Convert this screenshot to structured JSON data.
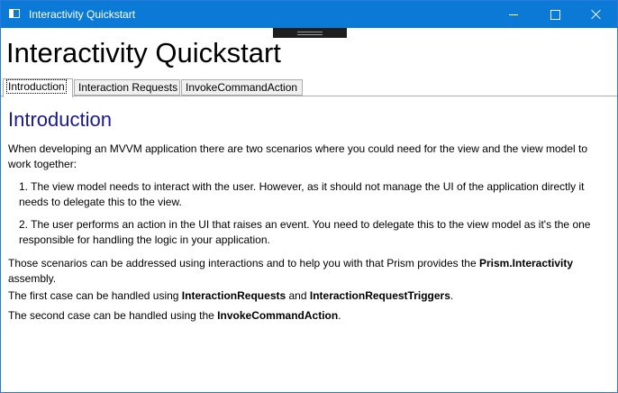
{
  "window": {
    "title": "Interactivity Quickstart",
    "title_bar_color": "#0b7ad7",
    "icons": {
      "app": "window-icon",
      "minimize": "minimize-icon",
      "maximize": "maximize-icon",
      "close": "close-icon"
    }
  },
  "header": {
    "title": "Interactivity Quickstart"
  },
  "tabs": [
    {
      "label": "Introduction",
      "selected": true
    },
    {
      "label": "Interaction Requests",
      "selected": false
    },
    {
      "label": "InvokeCommandAction",
      "selected": false
    }
  ],
  "content": {
    "heading": "Introduction",
    "heading_color": "#1a1a8c",
    "intro": "When developing an MVVM application there are two scenarios where you could need for the view and the view model to work together:",
    "list_items": [
      "1. The view model needs to interact with the user. However, as it should not manage the UI of the application directly it needs to delegate this to the view.",
      "2. The user performs an action in the UI that raises an event. You need to delegate this to the view model as it's the one responsible for handling the logic in your application."
    ],
    "scenarios": {
      "prefix": "Those scenarios can be addressed using interactions and to help you with that Prism provides the ",
      "bold": "Prism.Interactivity",
      "suffix": " assembly."
    },
    "first_case": {
      "prefix": "The first case can be handled using ",
      "bold1": "InteractionRequests",
      "middle": " and ",
      "bold2": "InteractionRequestTriggers",
      "suffix": "."
    },
    "second_case": {
      "prefix": "The second case can be handled using the ",
      "bold": "InvokeCommandAction",
      "suffix": "."
    }
  }
}
